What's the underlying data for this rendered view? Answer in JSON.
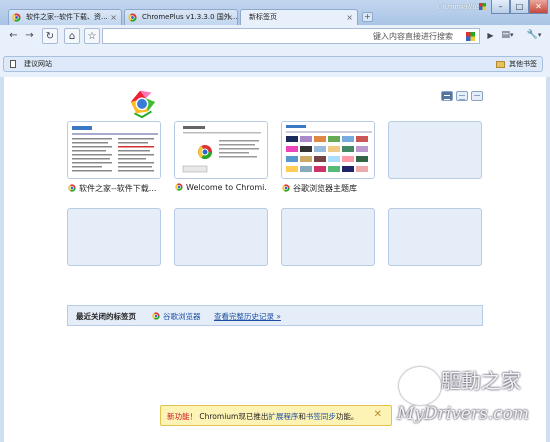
{
  "window": {
    "brand": "ChromePlus",
    "min_label": "–",
    "max_label": "□",
    "close_label": "✕"
  },
  "tabs": [
    {
      "label": "软件之家--软件下载、资...",
      "close": "×"
    },
    {
      "label": "ChromePlus v1.3.3.0 国外...",
      "close": "×"
    },
    {
      "label": "新标签页",
      "close": "×"
    }
  ],
  "new_tab_label": "+",
  "toolbar": {
    "back_icon": "←",
    "forward_icon": "→",
    "reload_icon": "↻",
    "home_icon": "⌂",
    "star_icon": "☆",
    "address_value": "",
    "address_hint": "键入内容直接进行搜索",
    "go_icon": "▶",
    "page_icon": "▤",
    "page_caret": "▾",
    "wrench_icon": "🔧",
    "wrench_caret": "▾"
  },
  "bookmarks": {
    "suggest": "建议网站",
    "other": "其他书签"
  },
  "thumbnails": [
    {
      "title": "软件之家--软件下载..."
    },
    {
      "title": "Welcome to Chromi..."
    },
    {
      "title": "谷歌浏览器主题库"
    }
  ],
  "recently_closed": {
    "label": "最近关闭的标签页",
    "item": "谷歌浏览器",
    "history_link": "查看完整历史记录 »"
  },
  "notification": {
    "highlight": "新功能！",
    "text_1": " Chromium现已推出",
    "link_1": "扩展程序",
    "text_2": "和",
    "link_2": "书签同步",
    "text_3": "功能。",
    "close": "✕"
  },
  "watermark": {
    "cn": "驅動之家",
    "en": "MyDrivers.com"
  },
  "colors": {
    "chrome_blue": "#cfdff2",
    "accent_link": "#1b4fa3",
    "notify_bg": "#fdf3b4"
  }
}
